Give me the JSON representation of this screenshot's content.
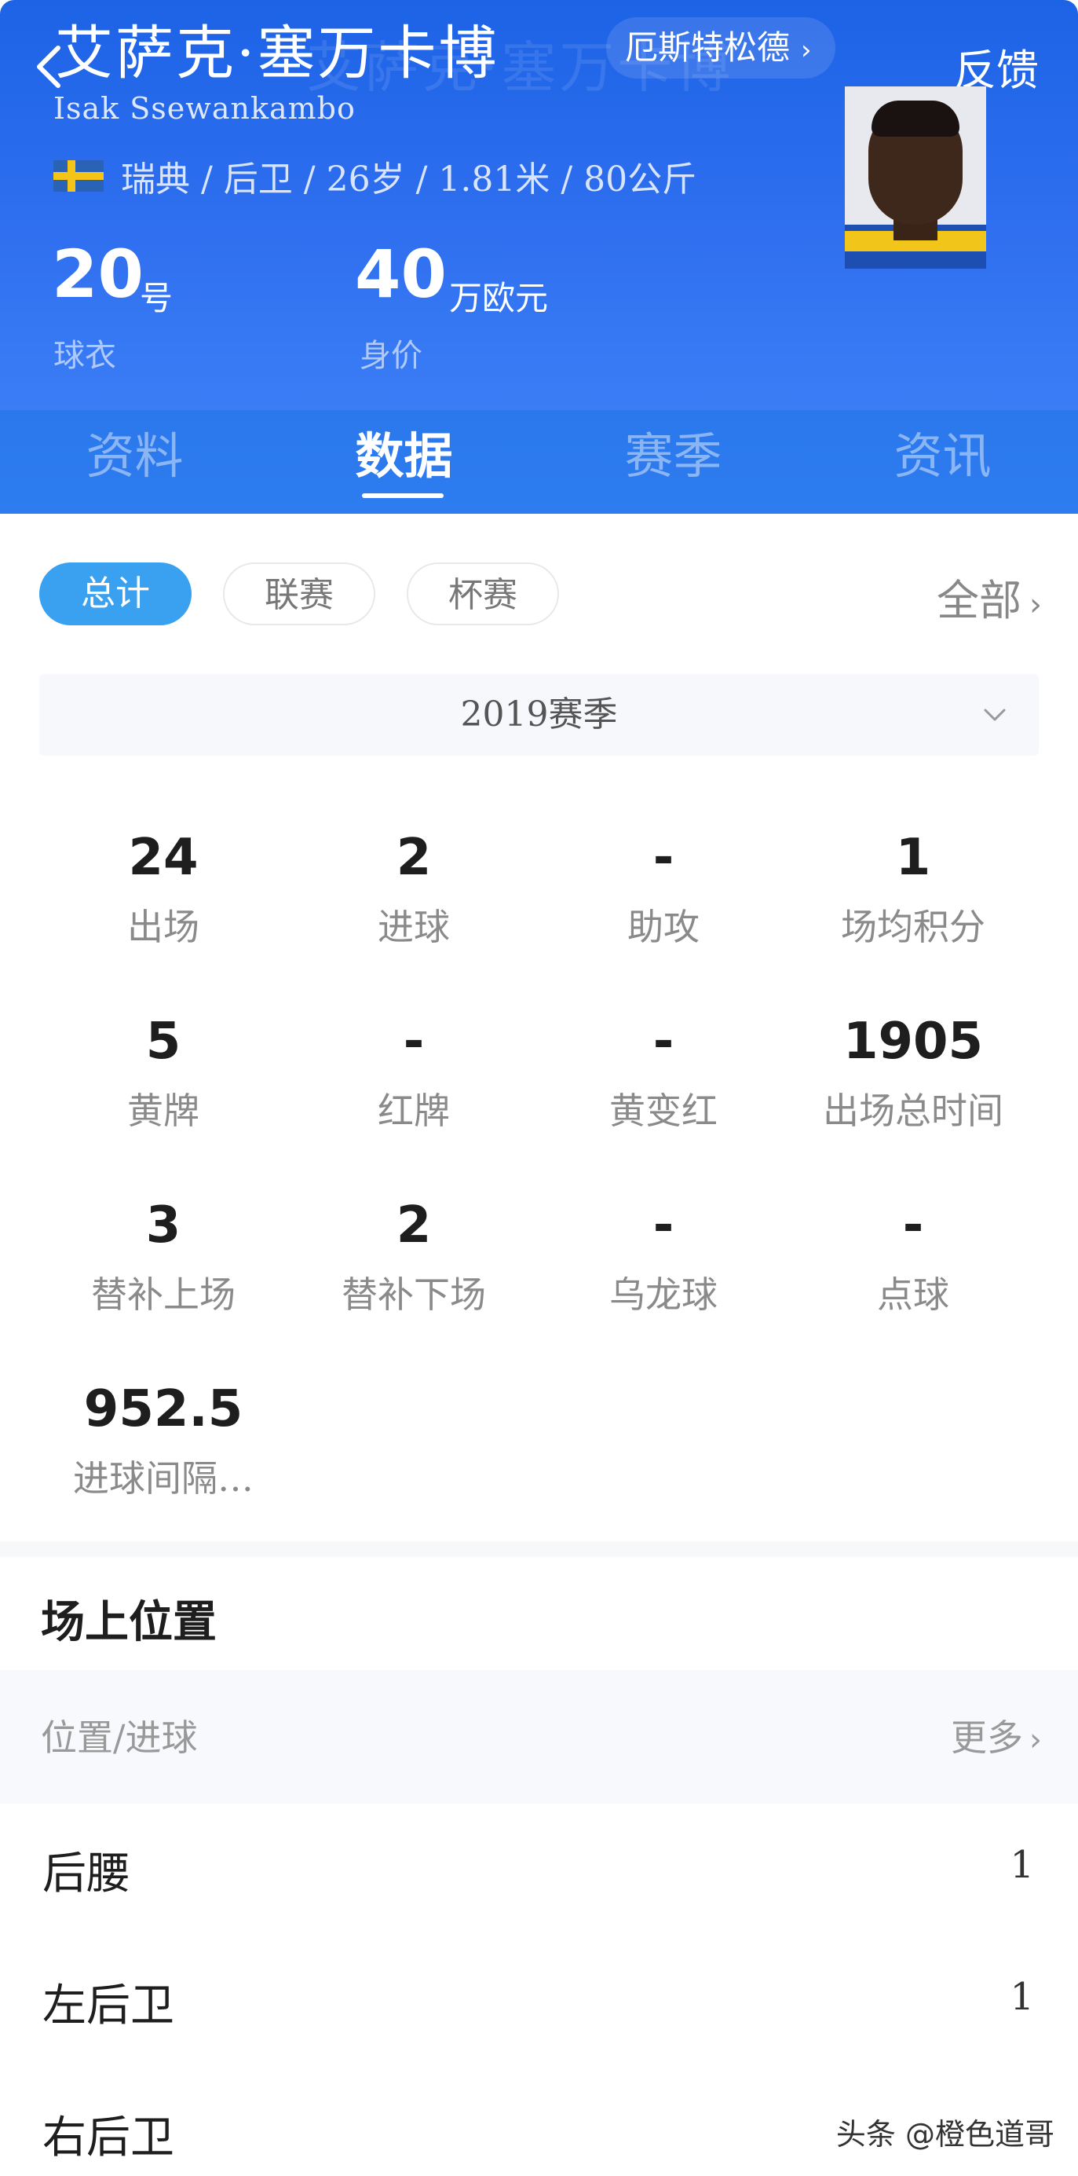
{
  "header": {
    "player_name_cn": "艾萨克·塞万卡博",
    "player_name_en": "Isak Ssewankambo",
    "club": "厄斯特松德",
    "feedback": "反馈",
    "info": "瑞典 / 后卫 / 26岁 / 1.81米 / 80公斤",
    "jersey_number": "20",
    "jersey_unit": "号",
    "jersey_label": "球衣",
    "value_number": "40",
    "value_unit": "万欧元",
    "value_label": "身价"
  },
  "tabs": [
    "资料",
    "数据",
    "赛季",
    "资讯"
  ],
  "active_tab": "数据",
  "filters": {
    "chips": [
      "总计",
      "联赛",
      "杯赛"
    ],
    "active": "总计",
    "all_label": "全部"
  },
  "season": {
    "selected": "2019赛季"
  },
  "stats": [
    {
      "value": "24",
      "label": "出场"
    },
    {
      "value": "2",
      "label": "进球"
    },
    {
      "value": "-",
      "label": "助攻"
    },
    {
      "value": "1",
      "label": "场均积分"
    },
    {
      "value": "5",
      "label": "黄牌"
    },
    {
      "value": "-",
      "label": "红牌"
    },
    {
      "value": "-",
      "label": "黄变红"
    },
    {
      "value": "1905",
      "label": "出场总时间"
    },
    {
      "value": "3",
      "label": "替补上场"
    },
    {
      "value": "2",
      "label": "替补下场"
    },
    {
      "value": "-",
      "label": "乌龙球"
    },
    {
      "value": "-",
      "label": "点球"
    },
    {
      "value": "952.5",
      "label": "进球间隔…"
    }
  ],
  "positions": {
    "title": "场上位置",
    "header_left": "位置/进球",
    "header_right": "更多",
    "rows": [
      {
        "name": "后腰",
        "goals": "1"
      },
      {
        "name": "左后卫",
        "goals": "1"
      },
      {
        "name": "右后卫",
        "goals": ""
      }
    ]
  },
  "watermark": "头条 @橙色道哥",
  "colors": {
    "header_blue": "#1d63e6",
    "chip_active": "#3aa0f0"
  }
}
